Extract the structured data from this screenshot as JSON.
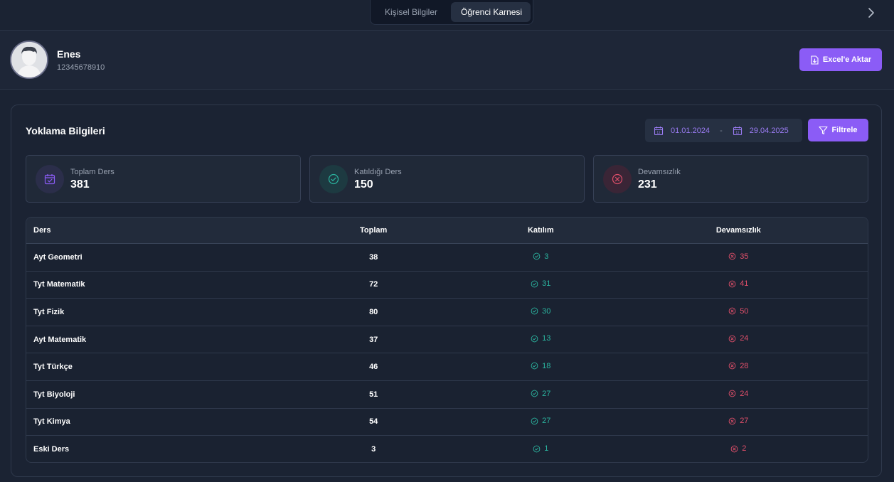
{
  "tabs": [
    {
      "label": "Kişisel Bilgiler",
      "active": false
    },
    {
      "label": "Öğrenci Karnesi",
      "active": true
    }
  ],
  "profile": {
    "name": "Enes",
    "id_number": "12345678910",
    "export_label": "Excel'e Aktar"
  },
  "attendance": {
    "title": "Yoklama Bilgileri",
    "date_start": "01.01.2024",
    "date_separator": "-",
    "date_end": "29.04.2025",
    "filter_label": "Filtrele",
    "stats": [
      {
        "label": "Toplam Ders",
        "value": "381"
      },
      {
        "label": "Katıldığı Ders",
        "value": "150"
      },
      {
        "label": "Devamsızlık",
        "value": "231"
      }
    ],
    "table": {
      "headers": [
        "Ders",
        "Toplam",
        "Katılım",
        "Devamsızlık"
      ],
      "rows": [
        {
          "ders": "Ayt Geometri",
          "toplam": "38",
          "katilim": "3",
          "devamsizlik": "35"
        },
        {
          "ders": "Tyt Matematik",
          "toplam": "72",
          "katilim": "31",
          "devamsizlik": "41"
        },
        {
          "ders": "Tyt Fizik",
          "toplam": "80",
          "katilim": "30",
          "devamsizlik": "50"
        },
        {
          "ders": "Ayt Matematik",
          "toplam": "37",
          "katilim": "13",
          "devamsizlik": "24"
        },
        {
          "ders": "Tyt Türkçe",
          "toplam": "46",
          "katilim": "18",
          "devamsizlik": "28"
        },
        {
          "ders": "Tyt Biyoloji",
          "toplam": "51",
          "katilim": "27",
          "devamsizlik": "24"
        },
        {
          "ders": "Tyt Kimya",
          "toplam": "54",
          "katilim": "27",
          "devamsizlik": "27"
        },
        {
          "ders": "Eski Ders",
          "toplam": "3",
          "katilim": "1",
          "devamsizlik": "2"
        }
      ]
    }
  },
  "colors": {
    "accent": "#8b5cf6",
    "success": "#2bb5a0",
    "danger": "#e04f6a"
  },
  "icons": {
    "next": "chevron-right-icon",
    "export": "file-download-icon",
    "calendar": "calendar-icon",
    "filter": "filter-icon",
    "total": "calendar-check-icon",
    "attended": "check-circle-icon",
    "absent": "x-circle-icon"
  }
}
